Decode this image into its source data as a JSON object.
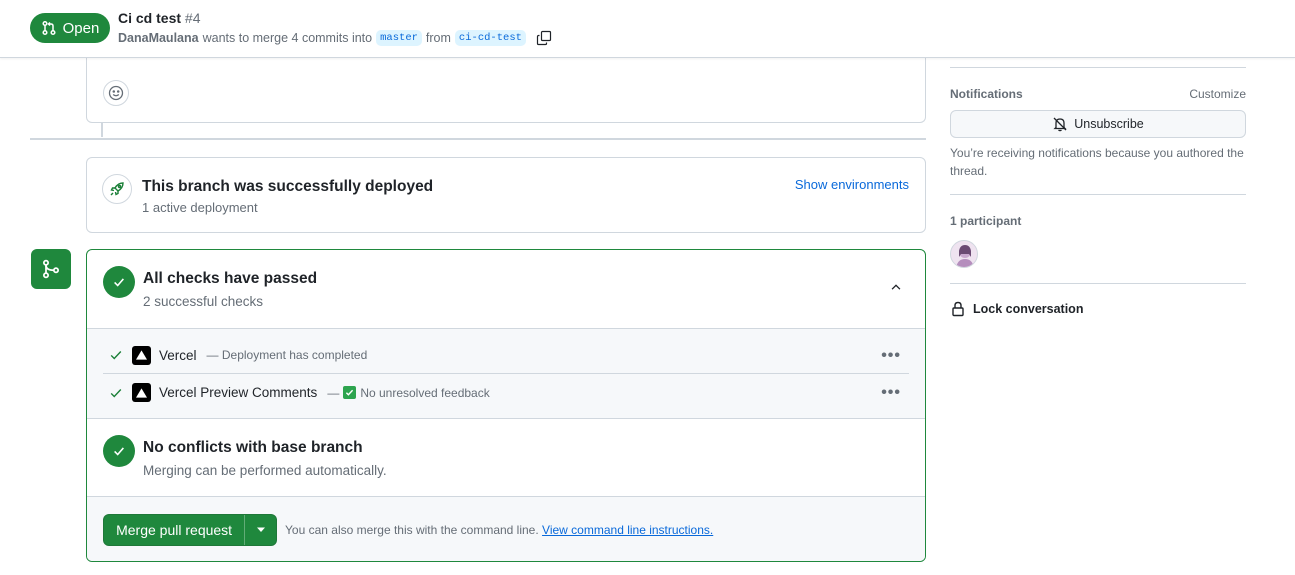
{
  "header": {
    "state": "Open",
    "title": "Ci cd test",
    "number": "#4",
    "author": "DanaMaulana",
    "merge_text": "wants to merge 4 commits into",
    "base_branch": "master",
    "from_text": "from",
    "head_branch": "ci-cd-test"
  },
  "deployment": {
    "title": "This branch was successfully deployed",
    "subtitle": "1 active deployment",
    "link": "Show environments"
  },
  "checks": {
    "title": "All checks have passed",
    "subtitle": "2 successful checks",
    "items": [
      {
        "name": "Vercel",
        "description": "— Deployment has completed"
      },
      {
        "name": "Vercel Preview Comments",
        "description_prefix": "—",
        "description": "No unresolved feedback"
      }
    ]
  },
  "conflicts": {
    "title": "No conflicts with base branch",
    "subtitle": "Merging can be performed automatically."
  },
  "merge": {
    "button_label": "Merge pull request",
    "hint": "You can also merge this with the command line.",
    "hint_link": "View command line instructions."
  },
  "sidebar": {
    "notifications_heading": "Notifications",
    "customize": "Customize",
    "unsubscribe": "Unsubscribe",
    "notifications_note": "You’re receiving notifications because you authored the thread.",
    "participants_heading": "1 participant",
    "lock": "Lock conversation"
  },
  "colors": {
    "accent_green": "#1f883d",
    "link_blue": "#0969da",
    "border": "#d0d7de"
  },
  "icons": [
    "git-pull-request-icon",
    "copy-icon",
    "smiley-icon",
    "rocket-icon",
    "git-merge-icon",
    "check-circle-icon",
    "chevron-up-icon",
    "check-icon",
    "vercel-icon",
    "kebab-horizontal-icon",
    "triangle-down-icon",
    "bell-slash-icon",
    "lock-icon"
  ]
}
